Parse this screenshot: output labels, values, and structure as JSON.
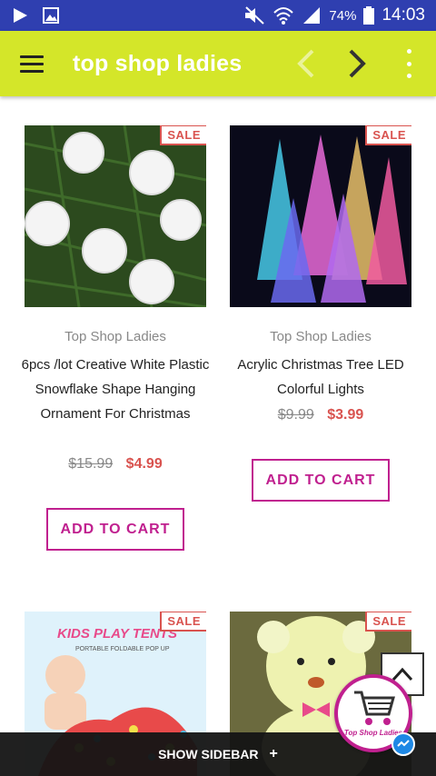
{
  "status_bar": {
    "battery": "74%",
    "time": "14:03",
    "icons": [
      "play-icon",
      "image-icon",
      "mute-icon",
      "wifi-icon",
      "signal-icon",
      "battery-icon"
    ]
  },
  "app_bar": {
    "title": "top shop ladies",
    "color": "#d4e629",
    "icons": [
      "hamburger-menu-icon",
      "chevron-left-icon",
      "chevron-right-icon",
      "more-vert-icon"
    ]
  },
  "products": [
    {
      "badge": "SALE",
      "vendor": "Top Shop Ladies",
      "name": "6pcs /lot Creative White Plastic Snowflake Shape Hanging Ornament For Christmas",
      "old_price": "$15.99",
      "price": "$4.99",
      "button": "ADD TO CART"
    },
    {
      "badge": "SALE",
      "vendor": "Top Shop Ladies",
      "name": "Acrylic Christmas Tree LED Colorful Lights",
      "old_price": "$9.99",
      "price": "$3.99",
      "button": "ADD TO CART"
    },
    {
      "badge": "SALE",
      "image_text": "KIDS PLAY TENTS",
      "image_subtext": "PORTABLE FOLDABLE POP UP"
    },
    {
      "badge": "SALE"
    }
  ],
  "cart_fab": {
    "label": "Top Shop Ladies"
  },
  "bottom_bar": {
    "label": "SHOW SIDEBAR",
    "plus": "+"
  },
  "colors": {
    "accent": "#c0208f",
    "sale": "#d9534f",
    "status_bar": "#2f3fb0"
  }
}
